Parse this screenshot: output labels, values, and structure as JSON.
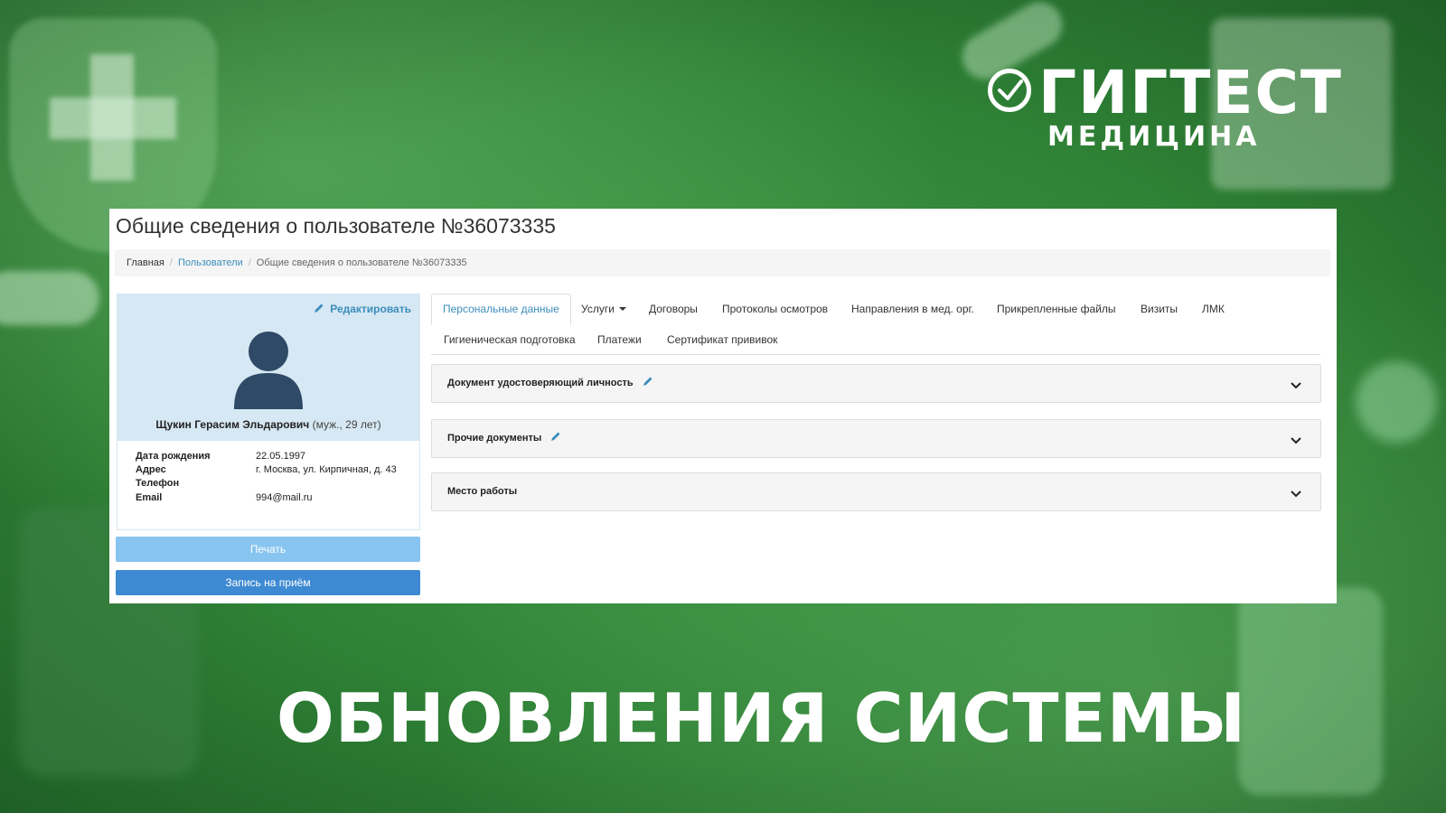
{
  "logo": {
    "title": "ГИГТЕСТ",
    "subtitle": "МЕДИЦИНА"
  },
  "page": {
    "title": "Общие сведения о пользователе №36073335"
  },
  "breadcrumb": {
    "home": "Главная",
    "users": "Пользователи",
    "current": "Общие сведения о пользователе №36073335"
  },
  "profile": {
    "edit_label": "Редактировать",
    "name": "Щукин Герасим Эльдарович",
    "details": "(муж., 29 лет)",
    "fields": [
      {
        "label": "Дата рождения",
        "value": "22.05.1997"
      },
      {
        "label": "Адрес",
        "value": "г. Москва, ул. Кирпичная, д. 43"
      },
      {
        "label": "Телефон",
        "value": ""
      },
      {
        "label": "Email",
        "value": "994@mail.ru"
      }
    ],
    "print_button": "Печать",
    "appointment_button": "Запись на приём"
  },
  "tabs": [
    {
      "label": "Персональные данные",
      "active": true
    },
    {
      "label": "Услуги",
      "dropdown": true
    },
    {
      "label": "Договоры"
    },
    {
      "label": "Протоколы осмотров"
    },
    {
      "label": "Направления в мед. орг."
    },
    {
      "label": "Прикрепленные файлы"
    },
    {
      "label": "Визиты"
    },
    {
      "label": "ЛМК"
    },
    {
      "label": "Гигиеническая подготовка"
    },
    {
      "label": "Платежи"
    },
    {
      "label": "Сертификат прививок"
    }
  ],
  "sections": [
    {
      "title": "Документ удостоверяющий личность",
      "editable": true
    },
    {
      "title": "Прочие документы",
      "editable": true
    },
    {
      "title": "Место работы",
      "editable": false
    }
  ],
  "headline": "ОБНОВЛЕНИЯ СИСТЕМЫ",
  "colors": {
    "accent": "#3c8dbc",
    "primary_button": "#3e8ad2",
    "disabled_button": "#88c4f0",
    "profile_bg": "#d6e8f3",
    "background_green": "#2f8236"
  }
}
